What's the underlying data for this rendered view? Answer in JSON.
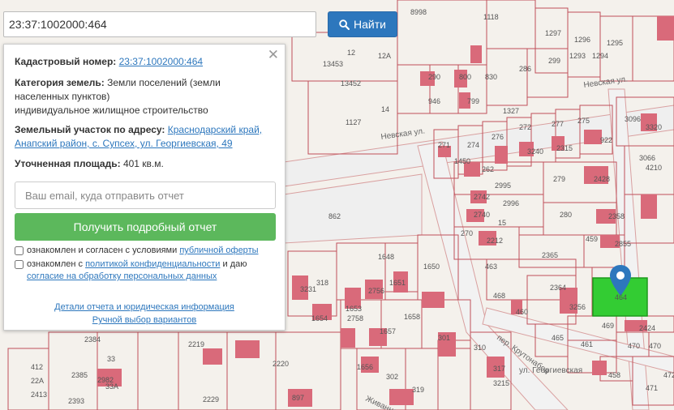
{
  "search": {
    "value": "23:37:1002000:464",
    "button_label": "Найти"
  },
  "panel": {
    "cadastral_label": "Кадастровый номер:",
    "cadastral_value": "23:37:1002000:464",
    "category_label": "Категория земель:",
    "category_value": "Земли поселений (земли населенных пунктов)",
    "usage": "индивидуальное жилищное строительство",
    "address_label": "Земельный участок по адресу:",
    "address_line1": "Краснодарский край,",
    "address_line2": "Анапский район, с. Супсех, ул. Георгиевская, 49",
    "area_label": "Уточненная площадь:",
    "area_value": "401 кв.м.",
    "email_placeholder": "Ваш email, куда отправить отчет",
    "get_button": "Получить подробный отчет",
    "agree1_text": "ознакомлен и согласен с условиями",
    "agree1_link": "публичной оферты",
    "agree2_text": "ознакомлен с",
    "agree2_link": "политикой конфиденциальности",
    "agree2_text2": "и даю",
    "agree2_link2": "согласие на обработку персональных данных",
    "details_link": "Детали отчета и юридическая информация",
    "manual_link": "Ручной выбор вариантов"
  },
  "map": {
    "parcel_labels": [
      "8998",
      "1118",
      "1297",
      "1296",
      "1295",
      "13453",
      "12",
      "12A",
      "13452",
      "290",
      "800",
      "830",
      "286",
      "299",
      "1293",
      "1294",
      "14",
      "946",
      "799",
      "1327",
      "1127",
      "3096",
      "3320",
      "271",
      "274",
      "276",
      "272",
      "277",
      "275",
      "3066",
      "1450",
      "262",
      "3240",
      "2315",
      "922",
      "4210",
      "279",
      "2428",
      "2995",
      "2742",
      "2996",
      "2740",
      "15",
      "280",
      "2358",
      "862",
      "270",
      "2212",
      "459",
      "2855",
      "2365",
      "463",
      "468",
      "460",
      "2364",
      "464",
      "3256",
      "469",
      "2424",
      "465",
      "461",
      "470",
      "458",
      "2384",
      "412",
      "2385",
      "22A",
      "2413",
      "2393",
      "33",
      "2219",
      "2220",
      "2229",
      "1654",
      "1653",
      "1657",
      "1658",
      "301",
      "310",
      "302",
      "319",
      "317",
      "3215",
      "897",
      "1656",
      "1648",
      "1651",
      "1650",
      "2756",
      "2758",
      "318",
      "3231",
      "2982",
      "33A",
      "471",
      "472",
      "470"
    ],
    "street_labels": [
      "Невская ул.",
      "Невская ул.",
      "пер. Крутонабов",
      "ул. Георгиевская",
      "Живанная ул."
    ],
    "highlight_parcel": "464"
  }
}
